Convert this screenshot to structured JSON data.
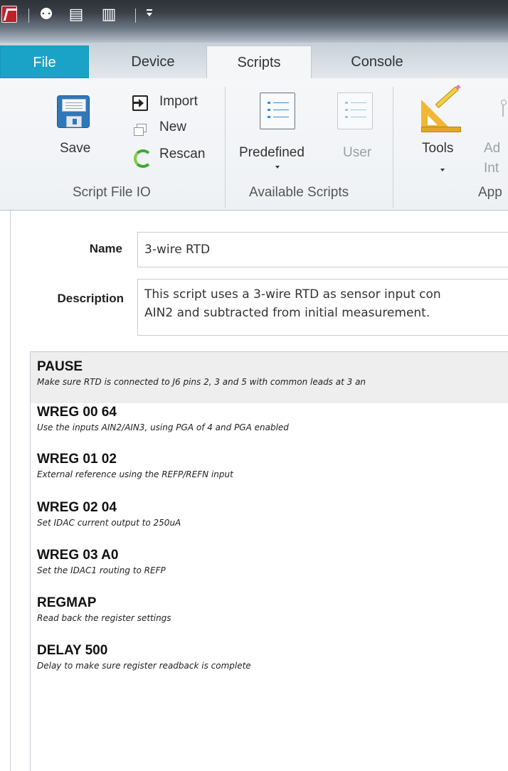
{
  "quick_access": {
    "icons": [
      "app-logo-icon",
      "users-icon",
      "document-icon",
      "book-icon",
      "customize-dropdown-icon"
    ]
  },
  "tabs": [
    {
      "label": "File",
      "active": false
    },
    {
      "label": "Device",
      "active": false
    },
    {
      "label": "Scripts",
      "active": true
    },
    {
      "label": "Console",
      "active": false
    }
  ],
  "ribbon": {
    "script_file_io": {
      "label": "Script File IO",
      "save": "Save",
      "import": "Import",
      "new": "New",
      "rescan": "Rescan"
    },
    "available_scripts": {
      "label": "Available Scripts",
      "predefined": "Predefined",
      "user": "User"
    },
    "apps": {
      "label": "App",
      "tools": "Tools",
      "add_line1": "Ad",
      "add_line2": "Int"
    }
  },
  "form": {
    "name_label": "Name",
    "name_value": "3-wire RTD",
    "description_label": "Description",
    "description_line1": "This script uses a 3-wire RTD as sensor input con",
    "description_line2": "AIN2 and subtracted from initial measurement."
  },
  "commands": [
    {
      "name": "PAUSE",
      "desc": "Make sure RTD is connected to J6 pins 2, 3 and 5 with common leads at 3 an",
      "selected": true
    },
    {
      "name": "WREG 00 64",
      "desc": "Use the inputs AIN2/AIN3, using PGA of 4 and PGA enabled",
      "selected": false
    },
    {
      "name": "WREG 01 02",
      "desc": "External reference using the REFP/REFN input",
      "selected": false
    },
    {
      "name": "WREG 02 04",
      "desc": "Set IDAC current output to 250uA",
      "selected": false
    },
    {
      "name": "WREG 03 A0",
      "desc": "Set the IDAC1 routing to REFP",
      "selected": false
    },
    {
      "name": "REGMAP",
      "desc": "Read back the register settings",
      "selected": false
    },
    {
      "name": "DELAY 500",
      "desc": "Delay to make sure register readback is complete",
      "selected": false
    }
  ],
  "colors": {
    "file_tab": "#1aa3c7",
    "title_bar": "#3b4048",
    "ribbon_bg": "#f6f7f9",
    "selected_row": "#eeeeee",
    "list_icon_accent": "#2e8fd6"
  }
}
